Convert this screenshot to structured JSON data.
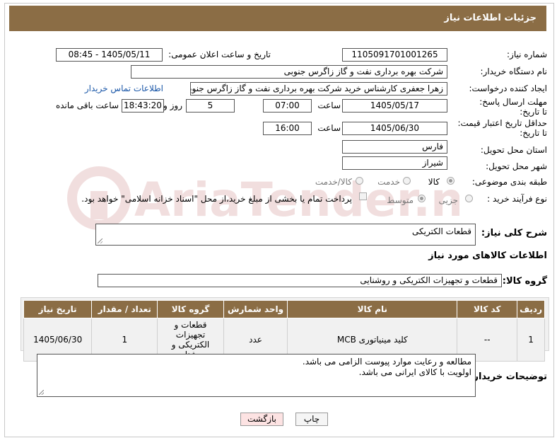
{
  "header": {
    "title": "جزئیات اطلاعات نیاز"
  },
  "fields": {
    "need_number_label": "شماره نیاز:",
    "need_number": "1105091701001265",
    "announce_label": "تاریخ و ساعت اعلان عمومی:",
    "announce_value": "1405/05/11 - 08:45",
    "buyer_org_label": "نام دستگاه خریدار:",
    "buyer_org": "شرکت بهره برداری نفت و گاز زاگرس جنوبی",
    "requester_label": "ایجاد کننده درخواست:",
    "requester": "زهرا جعفری کارشناس خرید شرکت بهره برداری نفت و گاز زاگرس جنوبی",
    "contact_link": "اطلاعات تماس خریدار",
    "deadline_label": "مهلت ارسال پاسخ: تا تاریخ:",
    "deadline_date": "1405/05/17",
    "time_label": "ساعت",
    "deadline_time": "07:00",
    "days_value": "5",
    "days_label": "روز و",
    "remaining_value": "18:43:20",
    "remaining_label": "ساعت باقی مانده",
    "min_validity_label": "حداقل تاریخ اعتبار قیمت: تا تاریخ:",
    "validity_date": "1405/06/30",
    "validity_time": "16:00",
    "province_label": "استان محل تحویل:",
    "province": "فارس",
    "city_label": "شهر محل تحویل:",
    "city": "شیراز",
    "category_label": "طبقه بندی موضوعی:",
    "category_options": [
      "کالا",
      "خدمت",
      "کالا/خدمت"
    ],
    "process_label": "نوع فرآیند خرید :",
    "process_options": [
      "جزیی",
      "متوسط"
    ],
    "payment_note": "پرداخت تمام یا بخشی از مبلغ خرید،از محل \"اسناد خزانه اسلامی\" خواهد بود."
  },
  "summary": {
    "label": "شرح کلی نیاز:",
    "value": "قطعات الکتریکی"
  },
  "goods_section": {
    "title": "اطلاعات کالاهای مورد نیاز",
    "group_label": "گروه کالا:",
    "group_value": "قطعات و تجهیزات الکتریکی و روشنایی"
  },
  "table": {
    "headers": [
      "ردیف",
      "کد کالا",
      "نام کالا",
      "واحد شمارش",
      "گروه کالا",
      "تعداد / مقدار",
      "تاریخ نیاز"
    ],
    "rows": [
      {
        "row": "1",
        "code": "--",
        "name": "کلید مینیاتوری MCB",
        "unit": "عدد",
        "group": "قطعات و تجهیزات الکتریکی و روشنایی",
        "qty": "1",
        "date": "1405/06/30"
      }
    ]
  },
  "buyer_notes": {
    "label": "توضیحات خریدار:",
    "line1": "مطالعه و رعایت موارد پیوست الزامی می باشد.",
    "line2": "اولویت با کالای ایرانی می باشد."
  },
  "buttons": {
    "print": "چاپ",
    "back": "بازگشت"
  },
  "watermark": {
    "text": "AriaTender.neT",
    "color": "#e8c9c9"
  }
}
